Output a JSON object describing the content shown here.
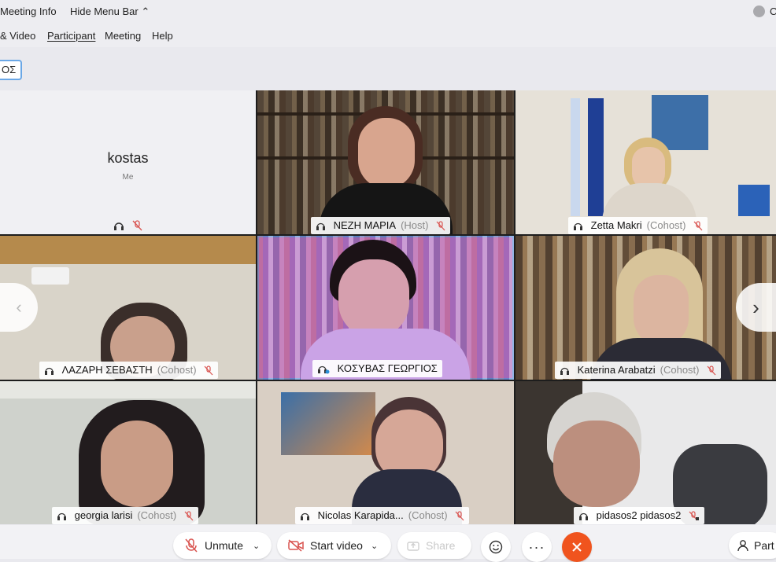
{
  "topbar": {
    "meeting_info": "Meeting Info",
    "hide_menu_bar": "Hide Menu Bar",
    "right_text": "C"
  },
  "menu": {
    "items": [
      "& Video",
      "Participant",
      "Meeting",
      "Help"
    ]
  },
  "chip_text": "ΟΣ",
  "tiles": {
    "kostas": {
      "name": "kostas",
      "sub": "Me"
    },
    "nezi": {
      "name": "ΝΕΖΗ ΜΑΡΙΑ",
      "role": "(Host)"
    },
    "zetta": {
      "name": "Zetta Makri",
      "role": "(Cohost)"
    },
    "lazari": {
      "name": "ΛΑΖΑΡΗ ΣΕΒΑΣΤΗ",
      "role": "(Cohost)"
    },
    "kouzvas": {
      "name": "ΚΟΣΥΒΑΣ ΓΕΩΡΓΙΟΣ"
    },
    "katerina": {
      "name": "Katerina Arabatzi",
      "role": "(Cohost)"
    },
    "georgia": {
      "name": "georgia larisi",
      "role": "(Cohost)"
    },
    "nicolas": {
      "name": "Nicolas Karapida...",
      "role": "(Cohost)"
    },
    "pidasos": {
      "name": "pidasos2 pidasos2"
    }
  },
  "controls": {
    "unmute": "Unmute",
    "start_video": "Start video",
    "share": "Share",
    "participants": "Part"
  },
  "colors": {
    "end_button": "#f0541e",
    "active_border": "#50b7f0",
    "mute_red": "#d9534f"
  }
}
